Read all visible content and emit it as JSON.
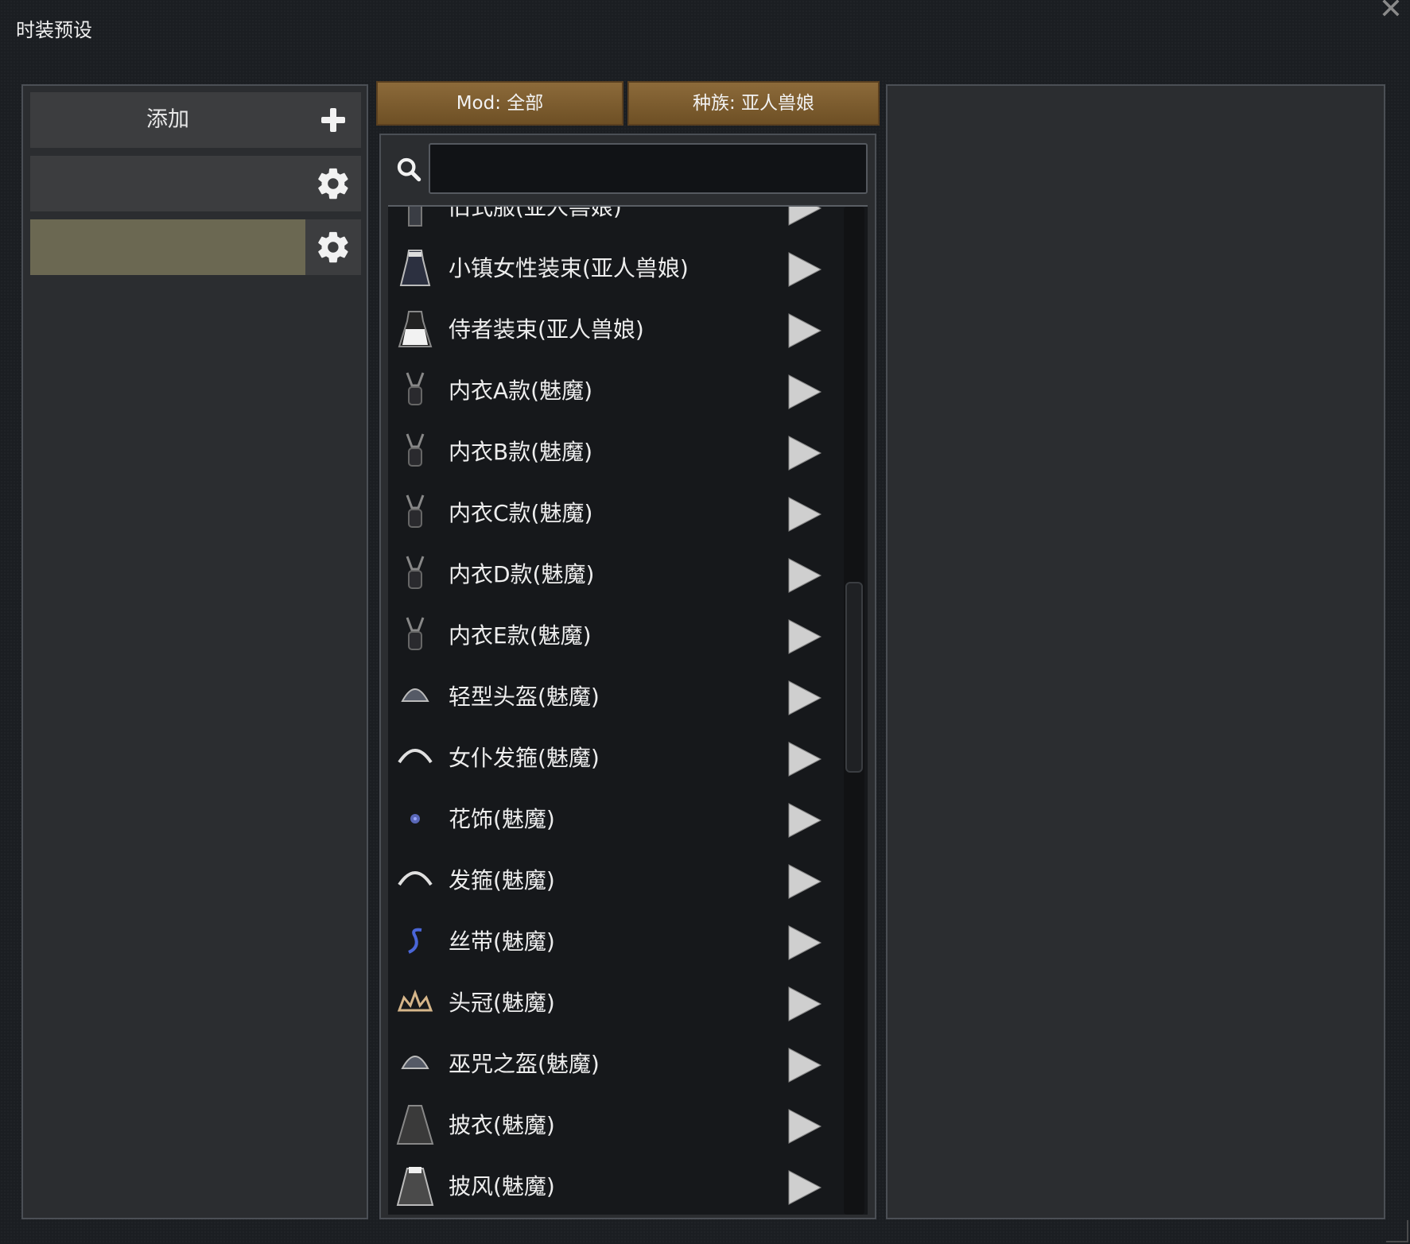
{
  "window": {
    "title": "时装预设"
  },
  "left": {
    "add_label": "添加"
  },
  "filters": {
    "mod_label": "Mod: 全部",
    "race_label": "种族: 亚人兽娘"
  },
  "search": {
    "value": "",
    "placeholder": ""
  },
  "list": {
    "items": [
      {
        "label": "旧式服(亚人兽娘)",
        "icon": "garment-icon"
      },
      {
        "label": "小镇女性装束(亚人兽娘)",
        "icon": "dress-icon"
      },
      {
        "label": "侍者装束(亚人兽娘)",
        "icon": "maid-dress-icon"
      },
      {
        "label": "内衣A款(魅魔)",
        "icon": "lingerie-icon"
      },
      {
        "label": "内衣B款(魅魔)",
        "icon": "lingerie-icon"
      },
      {
        "label": "内衣C款(魅魔)",
        "icon": "lingerie-icon"
      },
      {
        "label": "内衣D款(魅魔)",
        "icon": "lingerie-icon"
      },
      {
        "label": "内衣E款(魅魔)",
        "icon": "lingerie-icon"
      },
      {
        "label": "轻型头盔(魅魔)",
        "icon": "helmet-icon"
      },
      {
        "label": "女仆发箍(魅魔)",
        "icon": "headband-icon"
      },
      {
        "label": "花饰(魅魔)",
        "icon": "flower-icon"
      },
      {
        "label": "发箍(魅魔)",
        "icon": "headband-icon"
      },
      {
        "label": "丝带(魅魔)",
        "icon": "ribbon-icon"
      },
      {
        "label": "头冠(魅魔)",
        "icon": "tiara-icon"
      },
      {
        "label": "巫咒之盔(魅魔)",
        "icon": "helmet-icon"
      },
      {
        "label": "披衣(魅魔)",
        "icon": "cloak-icon"
      },
      {
        "label": "披风(魅魔)",
        "icon": "cape-icon"
      }
    ]
  },
  "colors": {
    "window_bg": "#1b1e22",
    "panel_bg": "#2b2d30",
    "selected_preset": "#6b6852",
    "filter_button": "#7d5c2f"
  }
}
